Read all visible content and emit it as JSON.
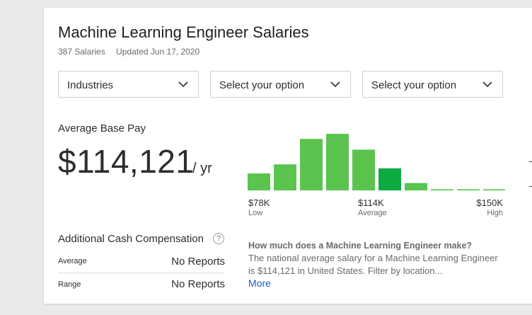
{
  "header": {
    "title": "Machine Learning Engineer Salaries",
    "count": "387 Salaries",
    "updated": "Updated Jun 17, 2020"
  },
  "filters": [
    {
      "label": "Industries"
    },
    {
      "label": "Select your option"
    },
    {
      "label": "Select your option"
    }
  ],
  "base_pay": {
    "label": "Average Base Pay",
    "value": "$114,121",
    "unit": "/ yr"
  },
  "histogram": {
    "bar_color": "#5ac44f",
    "highlight_color": "#0caa41",
    "highlight_index": 5,
    "values": [
      0.3,
      0.46,
      0.91,
      1.0,
      0.72,
      0.39,
      0.13,
      0.02,
      0.02,
      0.02
    ],
    "markers": [
      {
        "value": "$78K",
        "sub": "Low"
      },
      {
        "value": "$114K",
        "sub": "Average"
      },
      {
        "value": "$150K",
        "sub": "High"
      }
    ]
  },
  "additional_cash": {
    "title": "Additional Cash Compensation",
    "help_glyph": "?",
    "rows": [
      {
        "label": "Average",
        "value": "No Reports"
      },
      {
        "label": "Range",
        "value": "No Reports"
      }
    ]
  },
  "faq": {
    "question": "How much does a Machine Learning Engineer make?",
    "answer": "The national average salary for a Machine Learning Engineer is $114,121 in United States. Filter by location...",
    "more_label": "More"
  },
  "colors": {
    "link": "#1861bf",
    "text": "#2d2d2d"
  }
}
